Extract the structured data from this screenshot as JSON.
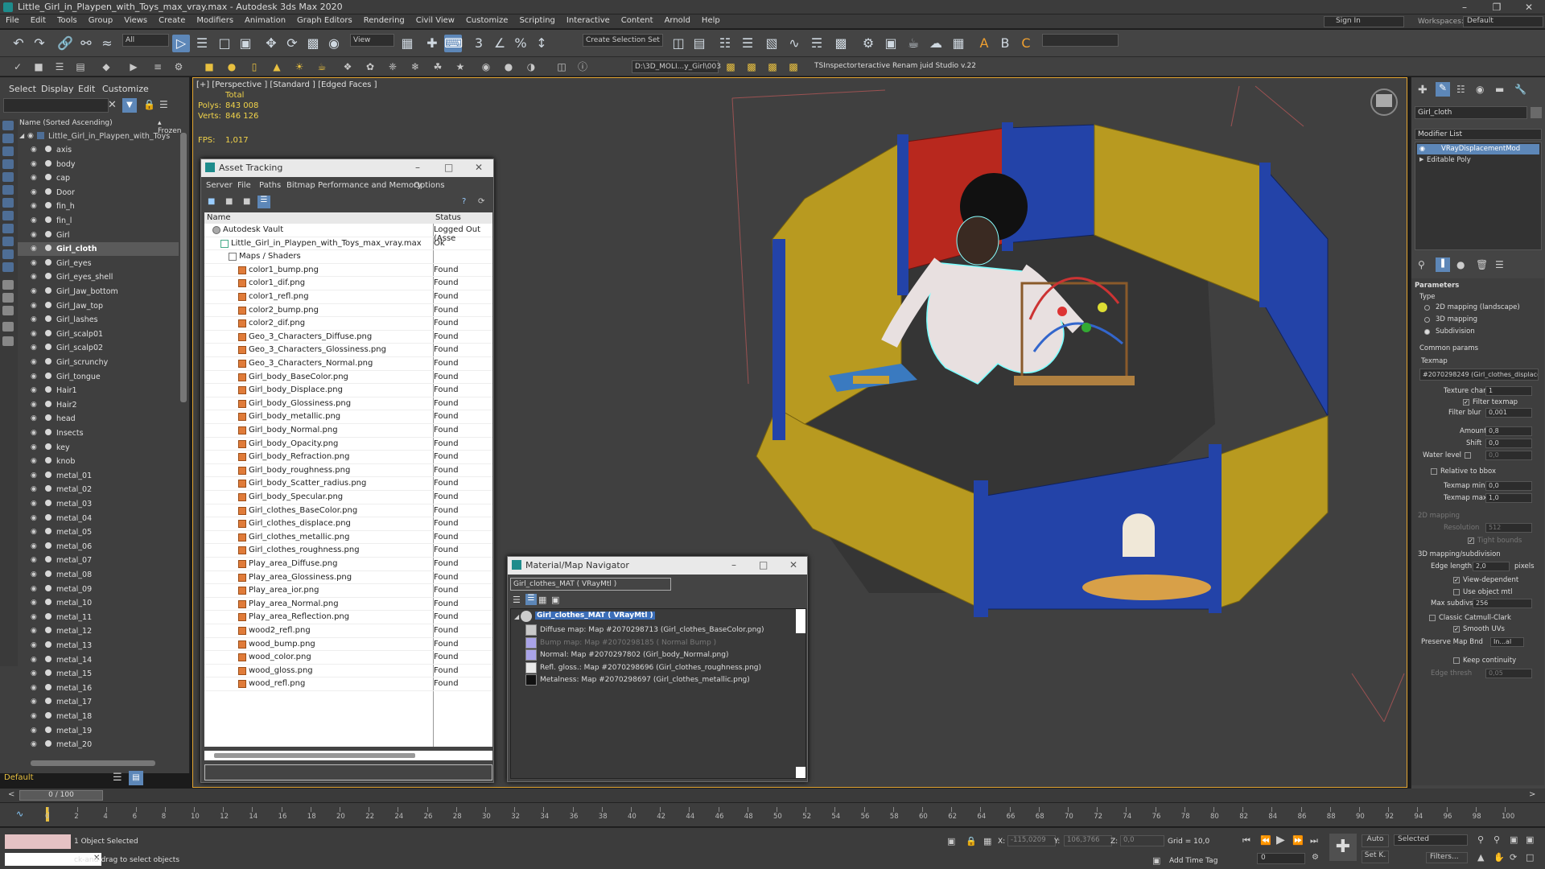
{
  "window": {
    "title": "Little_Girl_in_Playpen_with_Toys_max_vray.max - Autodesk 3ds Max 2020"
  },
  "menu": [
    "File",
    "Edit",
    "Tools",
    "Group",
    "Views",
    "Create",
    "Modifiers",
    "Animation",
    "Graph Editors",
    "Rendering",
    "Civil View",
    "Customize",
    "Scripting",
    "Interactive",
    "Content",
    "Arnold",
    "Help"
  ],
  "account": {
    "signin": "Sign In",
    "workspaces_label": "Workspaces:",
    "workspace": "Default"
  },
  "toolbar": {
    "selection_filter": "All",
    "ref_coord": "View",
    "selection_set": "Create Selection Set",
    "path": "D:\\3D_MOLI...y_Girl\\003",
    "tsinspector": "TSInspector",
    "renamer": "teractive Renam juid Studio v.22"
  },
  "explorer": {
    "tabs": [
      "Select",
      "Display",
      "Edit",
      "Customize"
    ],
    "header_name": "Name (Sorted Ascending)",
    "header_frozen": "▴ Frozen",
    "root": "Little_Girl_in_Playpen_with_Toys",
    "selected": "Girl_cloth",
    "items": [
      "axis",
      "body",
      "cap",
      "Door",
      "fin_h",
      "fin_l",
      "Girl",
      "Girl_cloth",
      "Girl_eyes",
      "Girl_eyes_shell",
      "Girl_Jaw_bottom",
      "Girl_Jaw_top",
      "Girl_lashes",
      "Girl_scalp01",
      "Girl_scalp02",
      "Girl_scrunchy",
      "Girl_tongue",
      "Hair1",
      "Hair2",
      "head",
      "Insects",
      "key",
      "knob",
      "metal_01",
      "metal_02",
      "metal_03",
      "metal_04",
      "metal_05",
      "metal_06",
      "metal_07",
      "metal_08",
      "metal_09",
      "metal_10",
      "metal_11",
      "metal_12",
      "metal_13",
      "metal_14",
      "metal_15",
      "metal_16",
      "metal_17",
      "metal_18",
      "metal_19",
      "metal_20"
    ],
    "layer": "Default"
  },
  "viewport": {
    "label": "[+] [Perspective ] [Standard ] [Edged Faces ]",
    "total_label": "Total",
    "polys_label": "Polys:",
    "polys": "843 008",
    "verts_label": "Verts:",
    "verts": "846 126",
    "fps_label": "FPS:",
    "fps": "1,017"
  },
  "asset_tracking": {
    "title": "Asset Tracking",
    "menu": [
      "Server",
      "File",
      "Paths",
      "Bitmap Performance and Memory",
      "Options"
    ],
    "col_name": "Name",
    "col_status": "Status",
    "vault": {
      "name": "Autodesk Vault",
      "status": "Logged Out (Asse"
    },
    "scene": {
      "name": "Little_Girl_in_Playpen_with_Toys_max_vray.max",
      "status": "Ok"
    },
    "folder": "Maps / Shaders",
    "found": "Found",
    "files": [
      "color1_bump.png",
      "color1_dif.png",
      "color1_refl.png",
      "color2_bump.png",
      "color2_dif.png",
      "Geo_3_Characters_Diffuse.png",
      "Geo_3_Characters_Glossiness.png",
      "Geo_3_Characters_Normal.png",
      "Girl_body_BaseColor.png",
      "Girl_body_Displace.png",
      "Girl_body_Glossiness.png",
      "Girl_body_metallic.png",
      "Girl_body_Normal.png",
      "Girl_body_Opacity.png",
      "Girl_body_Refraction.png",
      "Girl_body_roughness.png",
      "Girl_body_Scatter_radius.png",
      "Girl_body_Specular.png",
      "Girl_clothes_BaseColor.png",
      "Girl_clothes_displace.png",
      "Girl_clothes_metallic.png",
      "Girl_clothes_roughness.png",
      "Play_area_Diffuse.png",
      "Play_area_Glossiness.png",
      "Play_area_ior.png",
      "Play_area_Normal.png",
      "Play_area_Reflection.png",
      "wood2_refl.png",
      "wood_bump.png",
      "wood_color.png",
      "wood_gloss.png",
      "wood_refl.png"
    ]
  },
  "navigator": {
    "title": "Material/Map Navigator",
    "current": "Girl_clothes_MAT  ( VRayMtl )",
    "root": "Girl_clothes_MAT  ( VRayMtl )",
    "maps": [
      {
        "label": "Diffuse map: Map #2070298713 (Girl_clothes_BaseColor.png)",
        "dim": false,
        "swatch": "#c9c9c9"
      },
      {
        "label": "Bump map: Map #2070298185 ( Normal Bump )",
        "dim": true,
        "swatch": "#a9a3e8"
      },
      {
        "label": "Normal: Map #2070297802 (Girl_body_Normal.png)",
        "dim": false,
        "swatch": "#a9a3e8"
      },
      {
        "label": "Refl. gloss.: Map #2070298696 (Girl_clothes_roughness.png)",
        "dim": false,
        "swatch": "#e9e9e9"
      },
      {
        "label": "Metalness: Map #2070298697 (Girl_clothes_metallic.png)",
        "dim": false,
        "swatch": "#111111"
      }
    ]
  },
  "command_panel": {
    "object_name": "Girl_cloth",
    "modifier_list": "Modifier List",
    "stack": [
      "VRayDisplacementMod",
      "Editable Poly"
    ],
    "parameters": "Parameters",
    "type_label": "Type",
    "types": [
      "2D mapping (landscape)",
      "3D mapping",
      "Subdivision"
    ],
    "type_selected": 2,
    "common_params": "Common params",
    "texmap_label": "Texmap",
    "texmap": "#2070298249 (Girl_clothes_displace",
    "texture_chan_label": "Texture chan",
    "texture_chan": "1",
    "filter_texmap": "Filter texmap",
    "filter_blur_label": "Filter blur",
    "filter_blur": "0,001",
    "amount_label": "Amount",
    "amount": "0,8",
    "shift_label": "Shift",
    "shift": "0,0",
    "water_level_label": "Water level",
    "water_level": "0,0",
    "relative_bbox": "Relative to bbox",
    "texmap_min_label": "Texmap min",
    "texmap_min": "0,0",
    "texmap_max_label": "Texmap max",
    "texmap_max": "1,0",
    "mapping2d": "2D mapping",
    "resolution_label": "Resolution",
    "resolution": "512",
    "tight_bounds": "Tight bounds",
    "mapping3d": "3D mapping/subdivision",
    "edge_length_label": "Edge length",
    "edge_length": "2,0",
    "pixels": "pixels",
    "view_dependent": "View-dependent",
    "use_object_mtl": "Use object mtl",
    "max_subdivs_label": "Max subdivs",
    "max_subdivs": "256",
    "catmull": "Classic Catmull-Clark",
    "smooth_uvs": "Smooth UVs",
    "preserve_label": "Preserve Map Bnd",
    "preserve": "In...al",
    "keep_continuity": "Keep continuity",
    "edge_thresh_label": "Edge thresh",
    "edge_thresh": "0,05"
  },
  "timeline": {
    "frame": "0 / 100",
    "ticks": [
      "0",
      "2",
      "4",
      "6",
      "8",
      "10",
      "12",
      "14",
      "16",
      "18",
      "20",
      "22",
      "24",
      "26",
      "28",
      "30",
      "32",
      "34",
      "36",
      "38",
      "40",
      "42",
      "44",
      "46",
      "48",
      "50",
      "52",
      "54",
      "56",
      "58",
      "60",
      "62",
      "64",
      "66",
      "68",
      "70",
      "72",
      "74",
      "76",
      "78",
      "80",
      "82",
      "84",
      "86",
      "88",
      "90",
      "92",
      "94",
      "96",
      "98",
      "100"
    ]
  },
  "status": {
    "selected": "1 Object Selected",
    "prompt": "ck-and-drag to select objects",
    "x_label": "X:",
    "x": "-115,0209",
    "y_label": "Y:",
    "y": "106,3766",
    "z_label": "Z:",
    "z": "0,0",
    "grid": "Grid = 10,0",
    "add_time_tag": "Add Time Tag",
    "auto": "Auto",
    "set_key": "Set K.",
    "key_filter": "Selected",
    "filters": "Filters...",
    "current_frame": "0"
  },
  "colors": {
    "accent": "#5d87b8",
    "viewport_border": "#e4a632",
    "stats": "#f1d34a"
  }
}
